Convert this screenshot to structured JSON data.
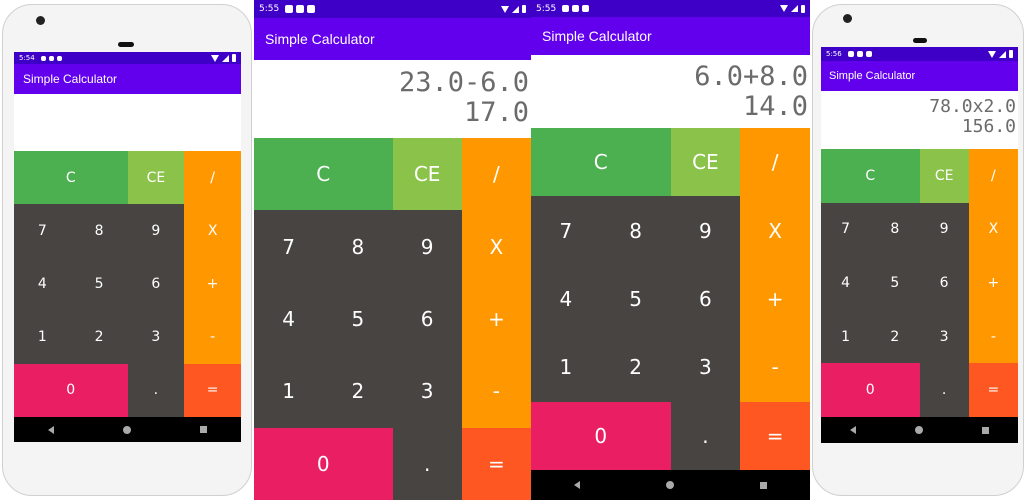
{
  "app": {
    "title": "Simple Calculator"
  },
  "colors": {
    "status_bar": "#3e00c6",
    "app_bar": "#6200ee",
    "clear_key": "#4caf50",
    "clear_entry_key": "#8bc34a",
    "operator_key": "#ff9800",
    "number_key": "#474441",
    "zero_key": "#e91e63",
    "equals_key": "#ff5722",
    "nav_bar": "#000000"
  },
  "screens": [
    {
      "time": "5:54",
      "expression": "",
      "result": ""
    },
    {
      "time": "5:55",
      "expression": "23.0-6.0",
      "result": "17.0"
    },
    {
      "time": "5:55",
      "expression": "6.0+8.0",
      "result": "14.0"
    },
    {
      "time": "5:56",
      "expression": "78.0x2.0",
      "result": "156.0"
    }
  ],
  "keys": {
    "clear": "C",
    "clear_entry": "CE",
    "divide": "/",
    "multiply": "X",
    "add": "+",
    "subtract": "-",
    "equals": "=",
    "decimal": ".",
    "n0": "0",
    "n1": "1",
    "n2": "2",
    "n3": "3",
    "n4": "4",
    "n5": "5",
    "n6": "6",
    "n7": "7",
    "n8": "8",
    "n9": "9"
  },
  "icons": {
    "status": [
      "notification-icon",
      "sync-icon",
      "sd-card-icon"
    ],
    "status_right": [
      "wifi-icon",
      "signal-icon",
      "battery-icon"
    ],
    "nav": [
      "back-icon",
      "home-icon",
      "recents-icon"
    ]
  }
}
